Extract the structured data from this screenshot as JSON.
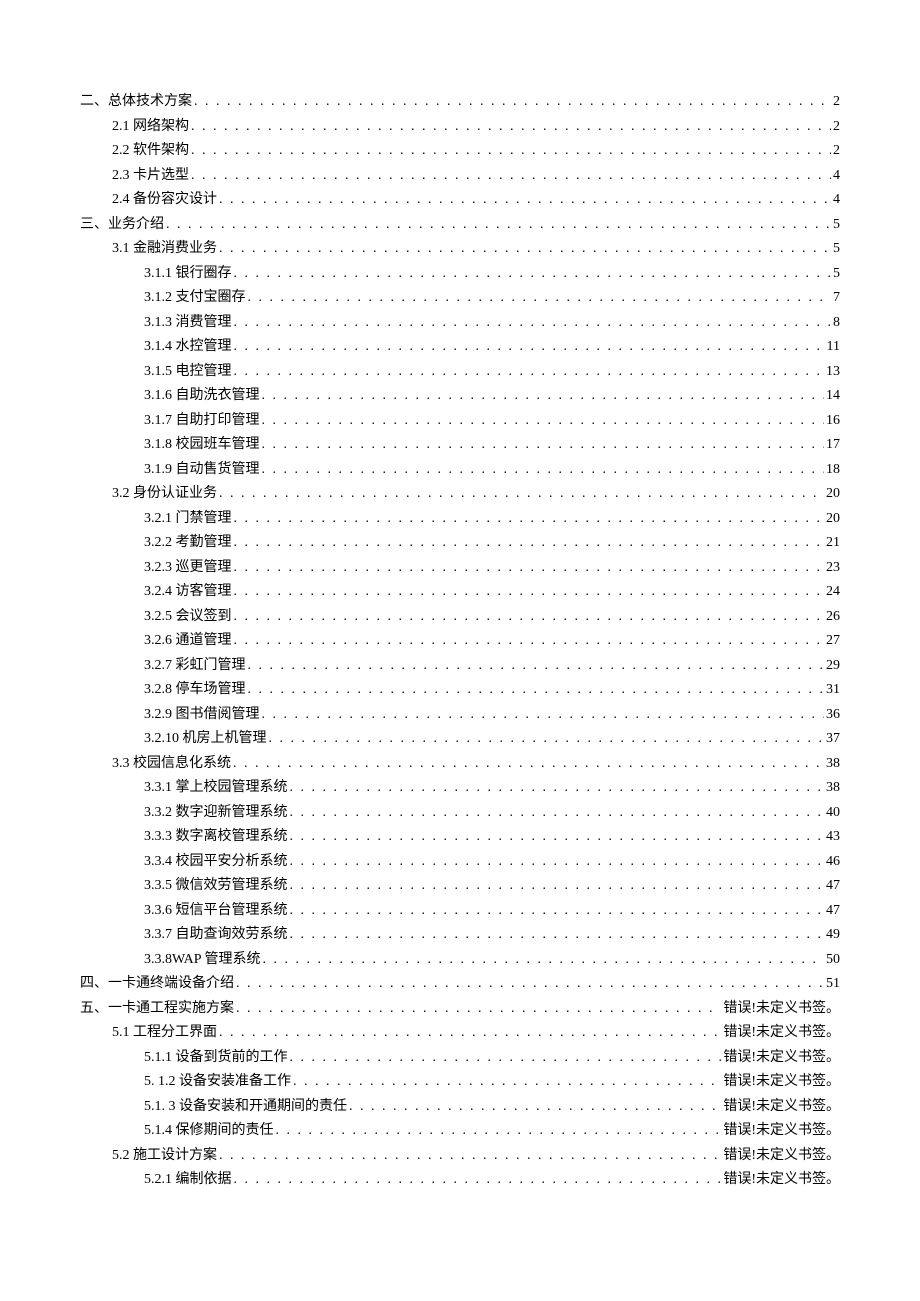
{
  "toc": [
    {
      "level": 1,
      "label": "二、总体技术方案",
      "page": "2"
    },
    {
      "level": 2,
      "label": "2.1 网络架构",
      "page": "2"
    },
    {
      "level": 2,
      "label": "2.2 软件架构",
      "page": "2"
    },
    {
      "level": 2,
      "label": "2.3 卡片选型",
      "page": "4"
    },
    {
      "level": 2,
      "label": "2.4 备份容灾设计",
      "page": "4"
    },
    {
      "level": 1,
      "label": "三、业务介绍",
      "page": "5"
    },
    {
      "level": 2,
      "label": "3.1 金融消费业务",
      "page": "5"
    },
    {
      "level": 3,
      "label": "3.1.1 银行圈存",
      "page": "5"
    },
    {
      "level": 3,
      "label": "3.1.2 支付宝圈存",
      "page": "7"
    },
    {
      "level": 3,
      "label": "3.1.3 消费管理",
      "page": "8"
    },
    {
      "level": 3,
      "label": "3.1.4 水控管理",
      "page": "11"
    },
    {
      "level": 3,
      "label": "3.1.5 电控管理",
      "page": "13"
    },
    {
      "level": 3,
      "label": "3.1.6 自助洗衣管理",
      "page": "14"
    },
    {
      "level": 3,
      "label": "3.1.7 自助打印管理",
      "page": "16"
    },
    {
      "level": 3,
      "label": "3.1.8 校园班车管理",
      "page": "17"
    },
    {
      "level": 3,
      "label": "3.1.9 自动售货管理",
      "page": "18"
    },
    {
      "level": 2,
      "label": "3.2 身份认证业务",
      "page": "20"
    },
    {
      "level": 3,
      "label": "3.2.1 门禁管理",
      "page": "20"
    },
    {
      "level": 3,
      "label": "3.2.2 考勤管理",
      "page": "21"
    },
    {
      "level": 3,
      "label": "3.2.3 巡更管理",
      "page": "23"
    },
    {
      "level": 3,
      "label": "3.2.4 访客管理",
      "page": "24"
    },
    {
      "level": 3,
      "label": "3.2.5 会议签到",
      "page": "26"
    },
    {
      "level": 3,
      "label": "3.2.6 通道管理",
      "page": "27"
    },
    {
      "level": 3,
      "label": "3.2.7 彩虹门管理",
      "page": "29"
    },
    {
      "level": 3,
      "label": "3.2.8 停车场管理",
      "page": "31"
    },
    {
      "level": 3,
      "label": "3.2.9 图书借阅管理",
      "page": "36"
    },
    {
      "level": 3,
      "label": "3.2.10 机房上机管理",
      "page": "37"
    },
    {
      "level": 2,
      "label": "3.3 校园信息化系统",
      "page": "38"
    },
    {
      "level": 3,
      "label": "3.3.1 掌上校园管理系统",
      "page": "38"
    },
    {
      "level": 3,
      "label": "3.3.2 数字迎新管理系统",
      "page": "40"
    },
    {
      "level": 3,
      "label": "3.3.3 数字离校管理系统",
      "page": "43"
    },
    {
      "level": 3,
      "label": "3.3.4 校园平安分析系统",
      "page": "46"
    },
    {
      "level": 3,
      "label": "3.3.5 微信效劳管理系统",
      "page": "47"
    },
    {
      "level": 3,
      "label": "3.3.6 短信平台管理系统",
      "page": "47"
    },
    {
      "level": 3,
      "label": "3.3.7 自助查询效劳系统",
      "page": "49"
    },
    {
      "level": 3,
      "label": "3.3.8WAP 管理系统",
      "page": "50"
    },
    {
      "level": 1,
      "label": "四、一卡通终端设备介绍",
      "page": "51"
    },
    {
      "level": 1,
      "label": "五、一卡通工程实施方案",
      "page": "错误!未定义书签。"
    },
    {
      "level": 2,
      "label": "5.1   工程分工界面",
      "page": "错误!未定义书签。"
    },
    {
      "level": 3,
      "label": "5.1.1    设备到货前的工作",
      "page": "错误!未定义书签。"
    },
    {
      "level": 3,
      "label": "5.  1.2 设备安装准备工作",
      "page": "错误!未定义书签。"
    },
    {
      "level": 3,
      "label": "5.1.   3 设备安装和开通期间的责任",
      "page": "错误!未定义书签。"
    },
    {
      "level": 3,
      "label": "5.1.4 保修期间的责任",
      "page": "错误!未定义书签。"
    },
    {
      "level": 2,
      "label": "5.2 施工设计方案",
      "page": "错误!未定义书签。"
    },
    {
      "level": 3,
      "label": "5.2.1 编制依据",
      "page": "错误!未定义书签。"
    }
  ]
}
